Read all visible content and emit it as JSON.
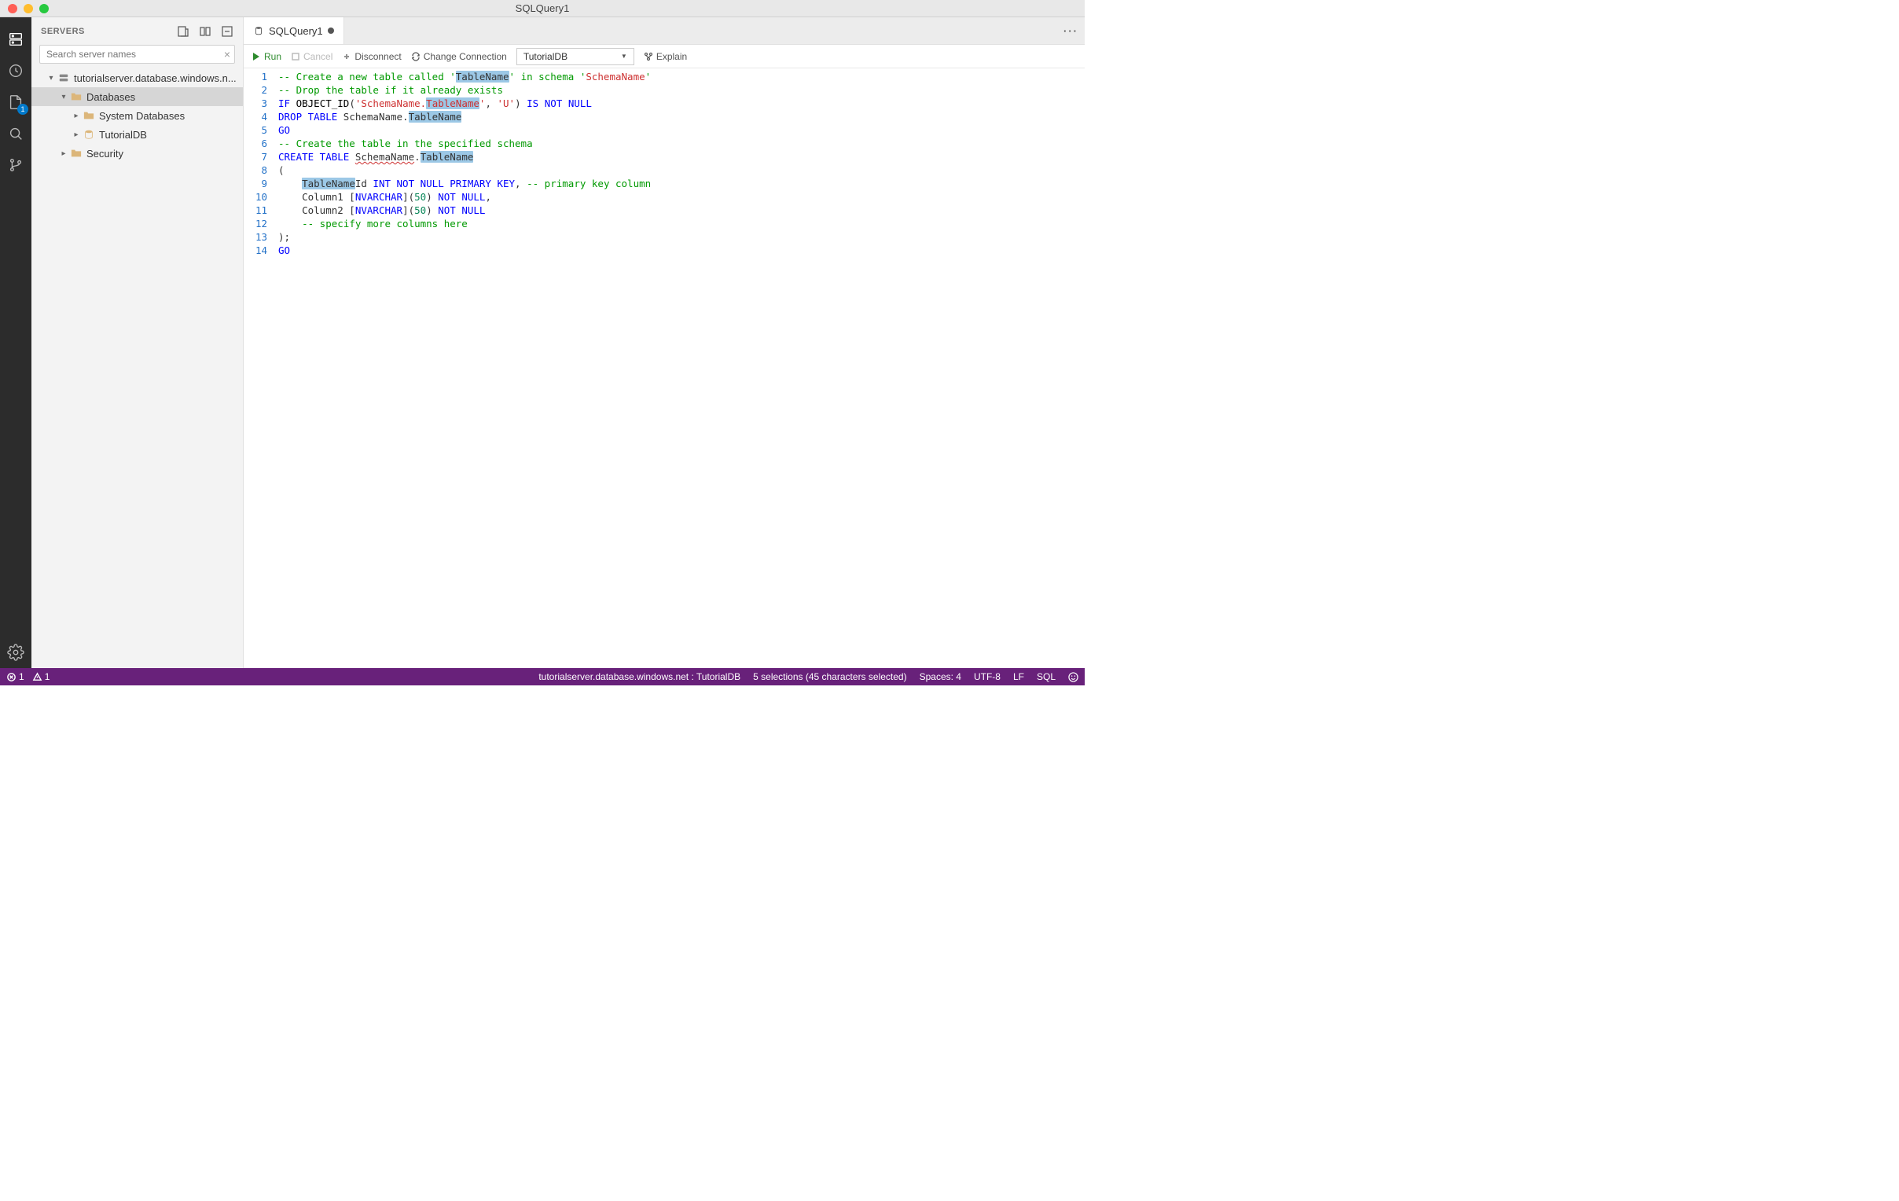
{
  "title": "SQLQuery1",
  "sidebar": {
    "header": "SERVERS",
    "search_placeholder": "Search server names",
    "server": "tutorialserver.database.windows.n...",
    "nodes": {
      "databases": "Databases",
      "system_databases": "System Databases",
      "tutorialdb": "TutorialDB",
      "security": "Security"
    }
  },
  "activity": {
    "file_badge": "1"
  },
  "tab": {
    "label": "SQLQuery1"
  },
  "toolbar": {
    "run": "Run",
    "cancel": "Cancel",
    "disconnect": "Disconnect",
    "change_connection": "Change Connection",
    "database": "TutorialDB",
    "explain": "Explain"
  },
  "code": {
    "line_count": 14,
    "lines": [
      {
        "n": 1,
        "tokens": [
          [
            "c-comment",
            "-- Create a new table called '"
          ],
          [
            "hl-sel",
            "TableName"
          ],
          [
            "c-comment",
            "' in schema '"
          ],
          [
            "c-string",
            "SchemaName"
          ],
          [
            "c-comment",
            "'"
          ]
        ]
      },
      {
        "n": 2,
        "tokens": [
          [
            "c-comment",
            "-- Drop the table if it already exists"
          ]
        ]
      },
      {
        "n": 3,
        "tokens": [
          [
            "c-keyword",
            "IF"
          ],
          [
            "",
            " "
          ],
          [
            "c-func",
            "OBJECT_ID"
          ],
          [
            "",
            "("
          ],
          [
            "c-string",
            "'SchemaName."
          ],
          [
            "hl-sel c-string",
            "TableName"
          ],
          [
            "c-string",
            "'"
          ],
          [
            "",
            ", "
          ],
          [
            "c-string",
            "'U'"
          ],
          [
            "",
            ") "
          ],
          [
            "c-keyword",
            "IS NOT NULL"
          ]
        ]
      },
      {
        "n": 4,
        "tokens": [
          [
            "c-keyword",
            "DROP TABLE"
          ],
          [
            "",
            " SchemaName."
          ],
          [
            "hl-sel",
            "TableName"
          ]
        ]
      },
      {
        "n": 5,
        "tokens": [
          [
            "c-keyword",
            "GO"
          ]
        ]
      },
      {
        "n": 6,
        "tokens": [
          [
            "c-comment",
            "-- Create the table in the specified schema"
          ]
        ]
      },
      {
        "n": 7,
        "tokens": [
          [
            "c-keyword",
            "CREATE TABLE"
          ],
          [
            "",
            " "
          ],
          [
            "wavy",
            "SchemaName"
          ],
          [
            "",
            "."
          ],
          [
            "hl-sel",
            "TableName"
          ]
        ]
      },
      {
        "n": 8,
        "tokens": [
          [
            "",
            "("
          ]
        ]
      },
      {
        "n": 9,
        "tokens": [
          [
            "",
            "    "
          ],
          [
            "hl-sel",
            "TableName"
          ],
          [
            "",
            "Id "
          ],
          [
            "c-keyword",
            "INT NOT NULL PRIMARY KEY"
          ],
          [
            "",
            ", "
          ],
          [
            "c-comment",
            "-- primary key column"
          ]
        ]
      },
      {
        "n": 10,
        "tokens": [
          [
            "",
            "    Column1 ["
          ],
          [
            "c-keyword",
            "NVARCHAR"
          ],
          [
            "",
            "]("
          ],
          [
            "c-number",
            "50"
          ],
          [
            "",
            ") "
          ],
          [
            "c-keyword",
            "NOT NULL"
          ],
          [
            "",
            ","
          ]
        ]
      },
      {
        "n": 11,
        "tokens": [
          [
            "",
            "    Column2 ["
          ],
          [
            "c-keyword",
            "NVARCHAR"
          ],
          [
            "",
            "]("
          ],
          [
            "c-number",
            "50"
          ],
          [
            "",
            ") "
          ],
          [
            "c-keyword",
            "NOT NULL"
          ]
        ]
      },
      {
        "n": 12,
        "tokens": [
          [
            "",
            "    "
          ],
          [
            "c-comment",
            "-- specify more columns here"
          ]
        ]
      },
      {
        "n": 13,
        "tokens": [
          [
            "",
            ");"
          ]
        ]
      },
      {
        "n": 14,
        "tokens": [
          [
            "c-keyword",
            "GO"
          ]
        ]
      }
    ]
  },
  "status": {
    "errors": "1",
    "warnings": "1",
    "connection": "tutorialserver.database.windows.net : TutorialDB",
    "selections": "5 selections (45 characters selected)",
    "spaces": "Spaces: 4",
    "encoding": "UTF-8",
    "eol": "LF",
    "language": "SQL"
  }
}
